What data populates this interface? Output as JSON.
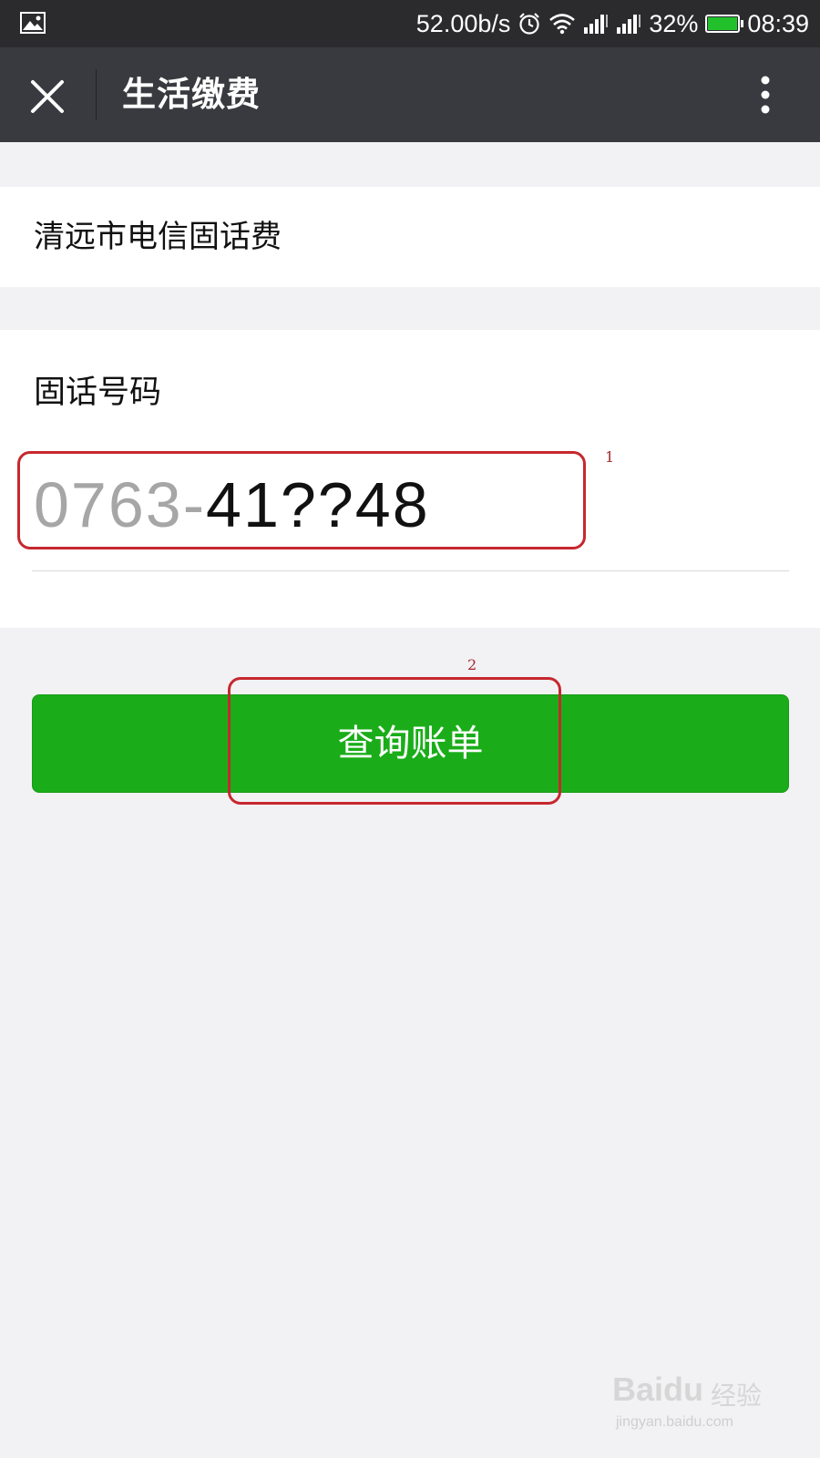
{
  "status_bar": {
    "net_speed": "52.00b/s",
    "battery_percent": "32%",
    "battery_level": 0.32,
    "time": "08:39",
    "icons": [
      "image-icon",
      "alarm-icon",
      "wifi-icon",
      "signal-icon",
      "signal-icon",
      "battery-icon"
    ]
  },
  "nav": {
    "title": "生活缴费",
    "close_icon": "close-icon",
    "more_icon": "more-vert-icon"
  },
  "company": {
    "name": "清远市电信固话费"
  },
  "phone": {
    "label": "固话号码",
    "value_prefix": "0763-",
    "value_rest": "41??48"
  },
  "query_button": {
    "label": "查询账单"
  },
  "annotations": {
    "marker_1": "1",
    "marker_2": "2",
    "color": "#c6282e"
  },
  "watermark": {
    "brand": "Baidu",
    "text": "经验",
    "url": "jingyan.baidu.com"
  },
  "colors": {
    "nav_bg": "#393a3f",
    "status_bg": "#2b2b2e",
    "page_bg": "#f2f1f4",
    "button_green": "#1aad19"
  }
}
